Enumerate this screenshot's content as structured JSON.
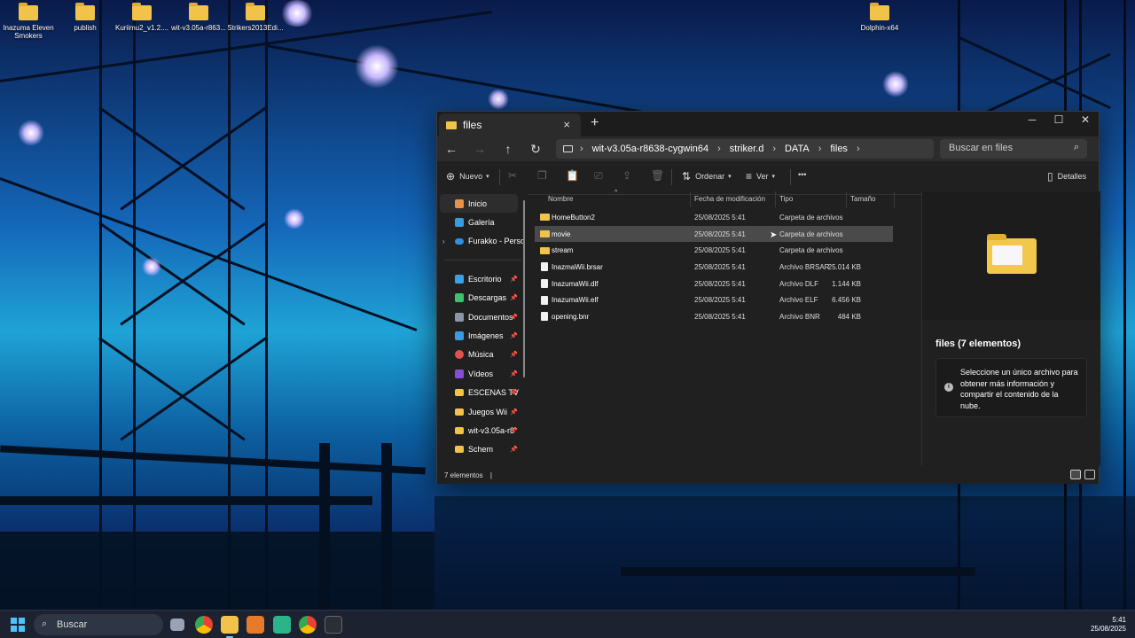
{
  "desktop": {
    "icons": [
      {
        "label": "Inazuma Eleven Smokers"
      },
      {
        "label": "publish"
      },
      {
        "label": "Kuriimu2_v1.2...."
      },
      {
        "label": "wit-v3.05a-r863..."
      },
      {
        "label": "Strikers2013Edi..."
      },
      {
        "label": "Dolphin-x64"
      }
    ]
  },
  "window": {
    "tab_title": "files",
    "new_tab": "+",
    "controls": {
      "minimize": "─",
      "maximize": "☐",
      "close": "✕"
    },
    "address": {
      "segments": [
        "wit-v3.05a-r8638-cygwin64",
        "striker.d",
        "DATA",
        "files"
      ],
      "separator": "›"
    },
    "search_placeholder": "Buscar en files",
    "toolbar": {
      "new_label": "Nuevo",
      "sort_label": "Ordenar",
      "view_label": "Ver",
      "more_label": "•••",
      "details_label": "Detalles"
    },
    "sidebar": {
      "top_items": [
        {
          "label": "Inicio",
          "icon": "home-icon",
          "active": true
        },
        {
          "label": "Galería",
          "icon": "gallery-icon"
        },
        {
          "label": "Furakko - Perso",
          "icon": "cloud-icon",
          "expandable": true
        }
      ],
      "pinned_items": [
        {
          "label": "Escritorio",
          "icon": "desktop-icon",
          "color": "#3aa0e8"
        },
        {
          "label": "Descargas",
          "icon": "download-icon",
          "color": "#3cc36b"
        },
        {
          "label": "Documentos",
          "icon": "documents-icon",
          "color": "#8a96a8"
        },
        {
          "label": "Imágenes",
          "icon": "pictures-icon",
          "color": "#3a9be0"
        },
        {
          "label": "Música",
          "icon": "music-icon",
          "color": "#e0524c"
        },
        {
          "label": "Vídeos",
          "icon": "videos-icon",
          "color": "#8a4cd6"
        },
        {
          "label": "ESCENAS TV",
          "icon": "folder-icon",
          "color": "#f1c34a"
        },
        {
          "label": "Juegos Wii",
          "icon": "folder-icon",
          "color": "#f1c34a"
        },
        {
          "label": "wit-v3.05a-r8",
          "icon": "folder-icon",
          "color": "#f1c34a"
        },
        {
          "label": "Schem",
          "icon": "folder-icon",
          "color": "#f1c34a"
        }
      ]
    },
    "columns": {
      "name": "Nombre",
      "date": "Fecha de modificación",
      "type": "Tipo",
      "size": "Tamaño"
    },
    "files": [
      {
        "name": "HomeButton2",
        "date": "25/08/2025 5:41",
        "type": "Carpeta de archivos",
        "size": "",
        "kind": "folder"
      },
      {
        "name": "movie",
        "date": "25/08/2025 5:41",
        "type": "Carpeta de archivos",
        "size": "",
        "kind": "folder",
        "selected": true
      },
      {
        "name": "stream",
        "date": "25/08/2025 5:41",
        "type": "Carpeta de archivos",
        "size": "",
        "kind": "folder"
      },
      {
        "name": "InazmaWii.brsar",
        "date": "25/08/2025 5:41",
        "type": "Archivo BRSAR",
        "size": "25.014 KB",
        "kind": "file"
      },
      {
        "name": "InazumaWii.dlf",
        "date": "25/08/2025 5:41",
        "type": "Archivo DLF",
        "size": "1.144 KB",
        "kind": "file"
      },
      {
        "name": "InazumaWii.elf",
        "date": "25/08/2025 5:41",
        "type": "Archivo ELF",
        "size": "6.456 KB",
        "kind": "file"
      },
      {
        "name": "opening.bnr",
        "date": "25/08/2025 5:41",
        "type": "Archivo BNR",
        "size": "484 KB",
        "kind": "file"
      }
    ],
    "details": {
      "title": "files (7 elementos)",
      "info": "Seleccione un único archivo para obtener más información y compartir el contenido de la nube."
    },
    "status": {
      "count": "7 elementos",
      "cursor": "|"
    }
  },
  "taskbar": {
    "search_label": "Buscar",
    "time": "5:41",
    "date": "25/08/2025"
  }
}
